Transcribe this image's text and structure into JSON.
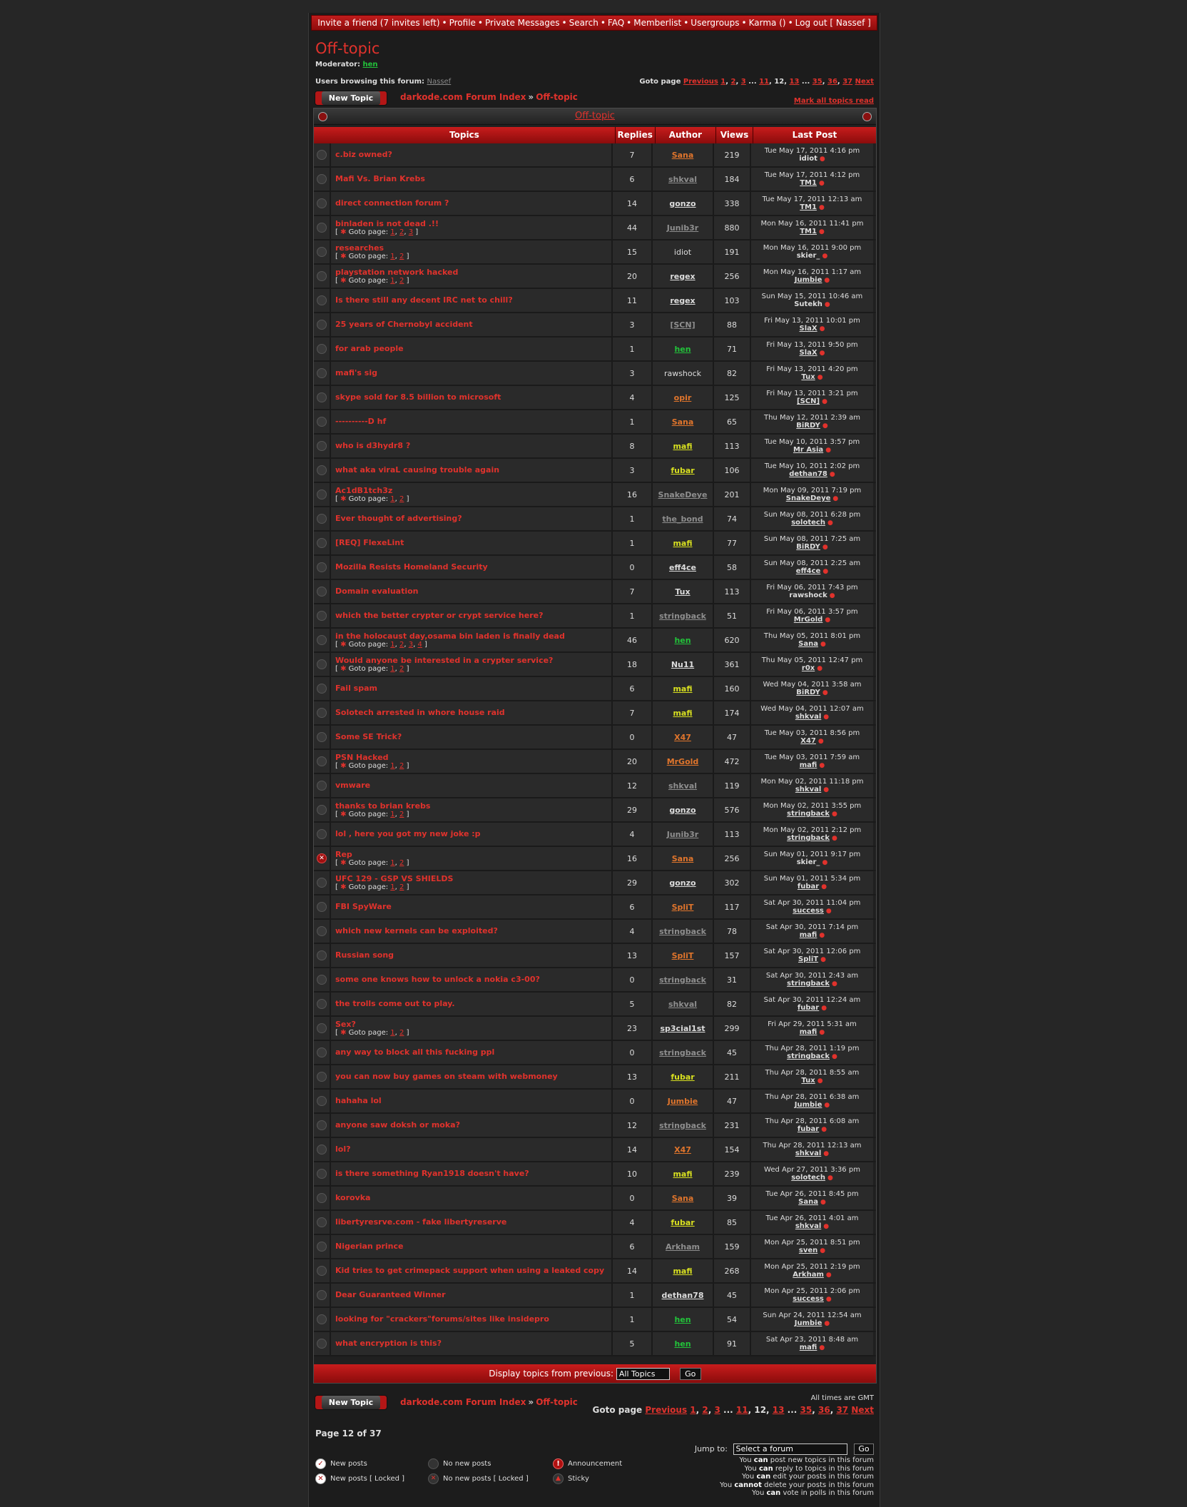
{
  "topnav": {
    "items": [
      "Invite a friend (7 invites left)",
      "Profile",
      "Private Messages",
      "Search",
      "FAQ",
      "Memberlist",
      "Usergroups",
      "Karma ()",
      "Log out [ Nassef ]"
    ]
  },
  "forum": {
    "title": "Off-topic",
    "moderator_label": "Moderator:",
    "moderator": "hen",
    "browsing_label": "Users browsing this forum:",
    "browsing_user": "Nassef"
  },
  "pagination": {
    "label": "Goto page",
    "previous": "Previous",
    "next": "Next",
    "pages_before": [
      "1",
      "2",
      "3"
    ],
    "ellipsis": "...",
    "pages_mid": [
      "11",
      "12",
      "13"
    ],
    "current": "12",
    "pages_after": [
      "35",
      "36",
      "37"
    ],
    "page_of": "Page 12 of 37"
  },
  "actions": {
    "new_topic": "New Topic",
    "mark_all": "Mark all topics read"
  },
  "breadcrumb": {
    "index": "darkode.com Forum Index",
    "sep": "»",
    "current": "Off-topic"
  },
  "table": {
    "panel_title": "Off-topic",
    "headers": [
      "Topics",
      "Replies",
      "Author",
      "Views",
      "Last Post"
    ],
    "goto_label": "Goto page:",
    "rows": [
      {
        "title": "c.biz owned?",
        "pages": [],
        "replies": "7",
        "author": "Sana",
        "ac": "orange",
        "views": "219",
        "date": "Tue May 17, 2011 4:16 pm",
        "by": "idiot",
        "bc": "plain",
        "locked": false
      },
      {
        "title": "Mafi Vs. Brian Krebs",
        "pages": [],
        "replies": "6",
        "author": "shkval",
        "ac": "gray",
        "views": "184",
        "date": "Tue May 17, 2011 4:12 pm",
        "by": "TM1",
        "bc": "white",
        "locked": false
      },
      {
        "title": "direct connection forum ?",
        "pages": [],
        "replies": "14",
        "author": "gonzo",
        "ac": "white",
        "views": "338",
        "date": "Tue May 17, 2011 12:13 am",
        "by": "TM1",
        "bc": "white",
        "locked": false
      },
      {
        "title": "binladen is not dead .!!",
        "pages": [
          "1",
          "2",
          "3"
        ],
        "replies": "44",
        "author": "Junib3r",
        "ac": "gray",
        "views": "880",
        "date": "Mon May 16, 2011 11:41 pm",
        "by": "TM1",
        "bc": "white",
        "locked": false
      },
      {
        "title": "researches",
        "pages": [
          "1",
          "2"
        ],
        "replies": "15",
        "author": "idiot",
        "ac": "plain",
        "views": "191",
        "date": "Mon May 16, 2011 9:00 pm",
        "by": "skier_",
        "bc": "plain",
        "locked": false
      },
      {
        "title": "playstation network hacked",
        "pages": [
          "1",
          "2"
        ],
        "replies": "20",
        "author": "regex",
        "ac": "white",
        "views": "256",
        "date": "Mon May 16, 2011 1:17 am",
        "by": "Jumbie",
        "bc": "white",
        "locked": false
      },
      {
        "title": "Is there still any decent IRC net to chill?",
        "pages": [],
        "replies": "11",
        "author": "regex",
        "ac": "white",
        "views": "103",
        "date": "Sun May 15, 2011 10:46 am",
        "by": "Sutekh",
        "bc": "plain",
        "locked": false
      },
      {
        "title": "25 years of Chernobyl accident",
        "pages": [],
        "replies": "3",
        "author": "[SCN]",
        "ac": "gray",
        "views": "88",
        "date": "Fri May 13, 2011 10:01 pm",
        "by": "SlaX",
        "bc": "white",
        "locked": false
      },
      {
        "title": "for arab people",
        "pages": [],
        "replies": "1",
        "author": "hen",
        "ac": "green",
        "views": "71",
        "date": "Fri May 13, 2011 9:50 pm",
        "by": "SlaX",
        "bc": "white",
        "locked": false
      },
      {
        "title": "mafi's sig",
        "pages": [],
        "replies": "3",
        "author": "rawshock",
        "ac": "plain",
        "views": "82",
        "date": "Fri May 13, 2011 4:20 pm",
        "by": "Tux",
        "bc": "white",
        "locked": false
      },
      {
        "title": "skype sold for 8.5 billion to microsoft",
        "pages": [],
        "replies": "4",
        "author": "opir",
        "ac": "orange",
        "views": "125",
        "date": "Fri May 13, 2011 3:21 pm",
        "by": "[SCN]",
        "bc": "white",
        "locked": false
      },
      {
        "title": "----------D hf",
        "pages": [],
        "replies": "1",
        "author": "Sana",
        "ac": "orange",
        "views": "65",
        "date": "Thu May 12, 2011 2:39 am",
        "by": "BiRDY",
        "bc": "white",
        "locked": false
      },
      {
        "title": "who is d3hydr8 ?",
        "pages": [],
        "replies": "8",
        "author": "mafi",
        "ac": "yellow",
        "views": "113",
        "date": "Tue May 10, 2011 3:57 pm",
        "by": "Mr Asia",
        "bc": "white",
        "locked": false
      },
      {
        "title": "what aka viraL causing trouble again",
        "pages": [],
        "replies": "3",
        "author": "fubar",
        "ac": "yellow",
        "views": "106",
        "date": "Tue May 10, 2011 2:02 pm",
        "by": "dethan78",
        "bc": "white",
        "locked": false
      },
      {
        "title": "Ac1dB1tch3z",
        "pages": [
          "1",
          "2"
        ],
        "replies": "16",
        "author": "SnakeDeye",
        "ac": "gray",
        "views": "201",
        "date": "Mon May 09, 2011 7:19 pm",
        "by": "SnakeDeye",
        "bc": "white",
        "locked": false
      },
      {
        "title": "Ever thought of advertising?",
        "pages": [],
        "replies": "1",
        "author": "the_bond",
        "ac": "gray",
        "views": "74",
        "date": "Sun May 08, 2011 6:28 pm",
        "by": "solotech",
        "bc": "white",
        "locked": false
      },
      {
        "title": "[REQ] FlexeLint",
        "pages": [],
        "replies": "1",
        "author": "mafi",
        "ac": "yellow",
        "views": "77",
        "date": "Sun May 08, 2011 7:25 am",
        "by": "BiRDY",
        "bc": "white",
        "locked": false
      },
      {
        "title": "Mozilla Resists Homeland Security",
        "pages": [],
        "replies": "0",
        "author": "eff4ce",
        "ac": "white",
        "views": "58",
        "date": "Sun May 08, 2011 2:25 am",
        "by": "eff4ce",
        "bc": "white",
        "locked": false
      },
      {
        "title": "Domain evaluation",
        "pages": [],
        "replies": "7",
        "author": "Tux",
        "ac": "white",
        "views": "113",
        "date": "Fri May 06, 2011 7:43 pm",
        "by": "rawshock",
        "bc": "plain",
        "locked": false
      },
      {
        "title": "which the better crypter or crypt service here?",
        "pages": [],
        "replies": "1",
        "author": "stringback",
        "ac": "gray",
        "views": "51",
        "date": "Fri May 06, 2011 3:57 pm",
        "by": "MrGold",
        "bc": "white",
        "locked": false
      },
      {
        "title": "in the holocaust day,osama bin laden is finally dead",
        "pages": [
          "1",
          "2",
          "3",
          "4"
        ],
        "replies": "46",
        "author": "hen",
        "ac": "green",
        "views": "620",
        "date": "Thu May 05, 2011 8:01 pm",
        "by": "Sana",
        "bc": "white",
        "locked": false
      },
      {
        "title": "Would anyone be interested in a crypter service?",
        "pages": [
          "1",
          "2"
        ],
        "replies": "18",
        "author": "Nu11",
        "ac": "white",
        "views": "361",
        "date": "Thu May 05, 2011 12:47 pm",
        "by": "r0x",
        "bc": "white",
        "locked": false
      },
      {
        "title": "Fail spam",
        "pages": [],
        "replies": "6",
        "author": "mafi",
        "ac": "yellow",
        "views": "160",
        "date": "Wed May 04, 2011 3:58 am",
        "by": "BiRDY",
        "bc": "white",
        "locked": false
      },
      {
        "title": "Solotech arrested in whore house raid",
        "pages": [],
        "replies": "7",
        "author": "mafi",
        "ac": "yellow",
        "views": "174",
        "date": "Wed May 04, 2011 12:07 am",
        "by": "shkval",
        "bc": "white",
        "locked": false
      },
      {
        "title": "Some SE Trick?",
        "pages": [],
        "replies": "0",
        "author": "X47",
        "ac": "orange",
        "views": "47",
        "date": "Tue May 03, 2011 8:56 pm",
        "by": "X47",
        "bc": "white",
        "locked": false
      },
      {
        "title": "PSN Hacked",
        "pages": [
          "1",
          "2"
        ],
        "replies": "20",
        "author": "MrGold",
        "ac": "orange",
        "views": "472",
        "date": "Tue May 03, 2011 7:59 am",
        "by": "mafi",
        "bc": "white",
        "locked": false
      },
      {
        "title": "vmware",
        "pages": [],
        "replies": "12",
        "author": "shkval",
        "ac": "gray",
        "views": "119",
        "date": "Mon May 02, 2011 11:18 pm",
        "by": "shkval",
        "bc": "white",
        "locked": false
      },
      {
        "title": "thanks to brian krebs",
        "pages": [
          "1",
          "2"
        ],
        "replies": "29",
        "author": "gonzo",
        "ac": "white",
        "views": "576",
        "date": "Mon May 02, 2011 3:55 pm",
        "by": "stringback",
        "bc": "white",
        "locked": false
      },
      {
        "title": "lol , here you got my new joke :p",
        "pages": [],
        "replies": "4",
        "author": "Junib3r",
        "ac": "gray",
        "views": "113",
        "date": "Mon May 02, 2011 2:12 pm",
        "by": "stringback",
        "bc": "white",
        "locked": false
      },
      {
        "title": "Rep",
        "pages": [
          "1",
          "2"
        ],
        "replies": "16",
        "author": "Sana",
        "ac": "orange",
        "views": "256",
        "date": "Sun May 01, 2011 9:17 pm",
        "by": "skier_",
        "bc": "plain",
        "locked": true
      },
      {
        "title": "UFC 129 - GSP VS SHIELDS",
        "pages": [
          "1",
          "2"
        ],
        "replies": "29",
        "author": "gonzo",
        "ac": "white",
        "views": "302",
        "date": "Sun May 01, 2011 5:34 pm",
        "by": "fubar",
        "bc": "white",
        "locked": false
      },
      {
        "title": "FBI SpyWare",
        "pages": [],
        "replies": "6",
        "author": "SpliT",
        "ac": "orange",
        "views": "117",
        "date": "Sat Apr 30, 2011 11:04 pm",
        "by": "success",
        "bc": "white",
        "locked": false
      },
      {
        "title": "which new kernels can be exploited?",
        "pages": [],
        "replies": "4",
        "author": "stringback",
        "ac": "gray",
        "views": "78",
        "date": "Sat Apr 30, 2011 7:14 pm",
        "by": "mafi",
        "bc": "white",
        "locked": false
      },
      {
        "title": "Russian song",
        "pages": [],
        "replies": "13",
        "author": "SpliT",
        "ac": "orange",
        "views": "157",
        "date": "Sat Apr 30, 2011 12:06 pm",
        "by": "SpliT",
        "bc": "white",
        "locked": false
      },
      {
        "title": "some one knows how to unlock a nokia c3-00?",
        "pages": [],
        "replies": "0",
        "author": "stringback",
        "ac": "gray",
        "views": "31",
        "date": "Sat Apr 30, 2011 2:43 am",
        "by": "stringback",
        "bc": "white",
        "locked": false
      },
      {
        "title": "the trolls come out to play.",
        "pages": [],
        "replies": "5",
        "author": "shkval",
        "ac": "gray",
        "views": "82",
        "date": "Sat Apr 30, 2011 12:24 am",
        "by": "fubar",
        "bc": "white",
        "locked": false
      },
      {
        "title": "Sex?",
        "pages": [
          "1",
          "2"
        ],
        "replies": "23",
        "author": "sp3cial1st",
        "ac": "white",
        "views": "299",
        "date": "Fri Apr 29, 2011 5:31 am",
        "by": "mafi",
        "bc": "white",
        "locked": false
      },
      {
        "title": "any way to block all this fucking ppl",
        "pages": [],
        "replies": "0",
        "author": "stringback",
        "ac": "gray",
        "views": "45",
        "date": "Thu Apr 28, 2011 1:19 pm",
        "by": "stringback",
        "bc": "white",
        "locked": false
      },
      {
        "title": "you can now buy games on steam with webmoney",
        "pages": [],
        "replies": "13",
        "author": "fubar",
        "ac": "yellow",
        "views": "211",
        "date": "Thu Apr 28, 2011 8:55 am",
        "by": "Tux",
        "bc": "white",
        "locked": false
      },
      {
        "title": "hahaha lol",
        "pages": [],
        "replies": "0",
        "author": "Jumbie",
        "ac": "orange",
        "views": "47",
        "date": "Thu Apr 28, 2011 6:38 am",
        "by": "Jumbie",
        "bc": "white",
        "locked": false
      },
      {
        "title": "anyone saw doksh or moka?",
        "pages": [],
        "replies": "12",
        "author": "stringback",
        "ac": "gray",
        "views": "231",
        "date": "Thu Apr 28, 2011 6:08 am",
        "by": "fubar",
        "bc": "white",
        "locked": false
      },
      {
        "title": "lol?",
        "pages": [],
        "replies": "14",
        "author": "X47",
        "ac": "orange",
        "views": "154",
        "date": "Thu Apr 28, 2011 12:13 am",
        "by": "shkval",
        "bc": "white",
        "locked": false
      },
      {
        "title": "is there something Ryan1918 doesn't have?",
        "pages": [],
        "replies": "10",
        "author": "mafi",
        "ac": "yellow",
        "views": "239",
        "date": "Wed Apr 27, 2011 3:36 pm",
        "by": "solotech",
        "bc": "white",
        "locked": false
      },
      {
        "title": "korovka",
        "pages": [],
        "replies": "0",
        "author": "Sana",
        "ac": "orange",
        "views": "39",
        "date": "Tue Apr 26, 2011 8:45 pm",
        "by": "Sana",
        "bc": "white",
        "locked": false
      },
      {
        "title": "libertyresrve.com - fake libertyreserve",
        "pages": [],
        "replies": "4",
        "author": "fubar",
        "ac": "yellow",
        "views": "85",
        "date": "Tue Apr 26, 2011 4:01 am",
        "by": "shkval",
        "bc": "white",
        "locked": false
      },
      {
        "title": "Nigerian prince",
        "pages": [],
        "replies": "6",
        "author": "Arkham",
        "ac": "gray",
        "views": "159",
        "date": "Mon Apr 25, 2011 8:51 pm",
        "by": "sven",
        "bc": "white",
        "locked": false
      },
      {
        "title": "Kid tries to get crimepack support when using a leaked copy",
        "pages": [],
        "replies": "14",
        "author": "mafi",
        "ac": "yellow",
        "views": "268",
        "date": "Mon Apr 25, 2011 2:19 pm",
        "by": "Arkham",
        "bc": "white",
        "locked": false
      },
      {
        "title": "Dear Guaranteed Winner",
        "pages": [],
        "replies": "1",
        "author": "dethan78",
        "ac": "white",
        "views": "45",
        "date": "Mon Apr 25, 2011 2:06 pm",
        "by": "success",
        "bc": "white",
        "locked": false
      },
      {
        "title": "looking for \"crackers\"forums/sites like insidepro",
        "pages": [],
        "replies": "1",
        "author": "hen",
        "ac": "green",
        "views": "54",
        "date": "Sun Apr 24, 2011 12:54 am",
        "by": "Jumbie",
        "bc": "white",
        "locked": false
      },
      {
        "title": "what encryption is this?",
        "pages": [],
        "replies": "5",
        "author": "hen",
        "ac": "green",
        "views": "91",
        "date": "Sat Apr 23, 2011 8:48 am",
        "by": "mafi",
        "bc": "white",
        "locked": false
      }
    ]
  },
  "display": {
    "label": "Display topics from previous:",
    "selected": "All Topics",
    "go": "Go"
  },
  "footer": {
    "all_times": "All times are GMT",
    "jump_label": "Jump to:",
    "jump_selected": "Select a forum",
    "jump_go": "Go",
    "legend": {
      "new_posts": "New posts",
      "new_posts_locked": "New posts [ Locked ]",
      "no_new_posts": "No new posts",
      "no_new_posts_locked": "No new posts [ Locked ]",
      "announcement": "Announcement",
      "sticky": "Sticky"
    },
    "permissions": [
      {
        "pre": "You",
        "strong": "can",
        "post": "post new topics in this forum"
      },
      {
        "pre": "You",
        "strong": "can",
        "post": "reply to topics in this forum"
      },
      {
        "pre": "You",
        "strong": "can",
        "post": "edit your posts in this forum"
      },
      {
        "pre": "You",
        "strong": "cannot",
        "post": "delete your posts in this forum"
      },
      {
        "pre": "You",
        "strong": "can",
        "post": "vote in polls in this forum"
      }
    ]
  }
}
